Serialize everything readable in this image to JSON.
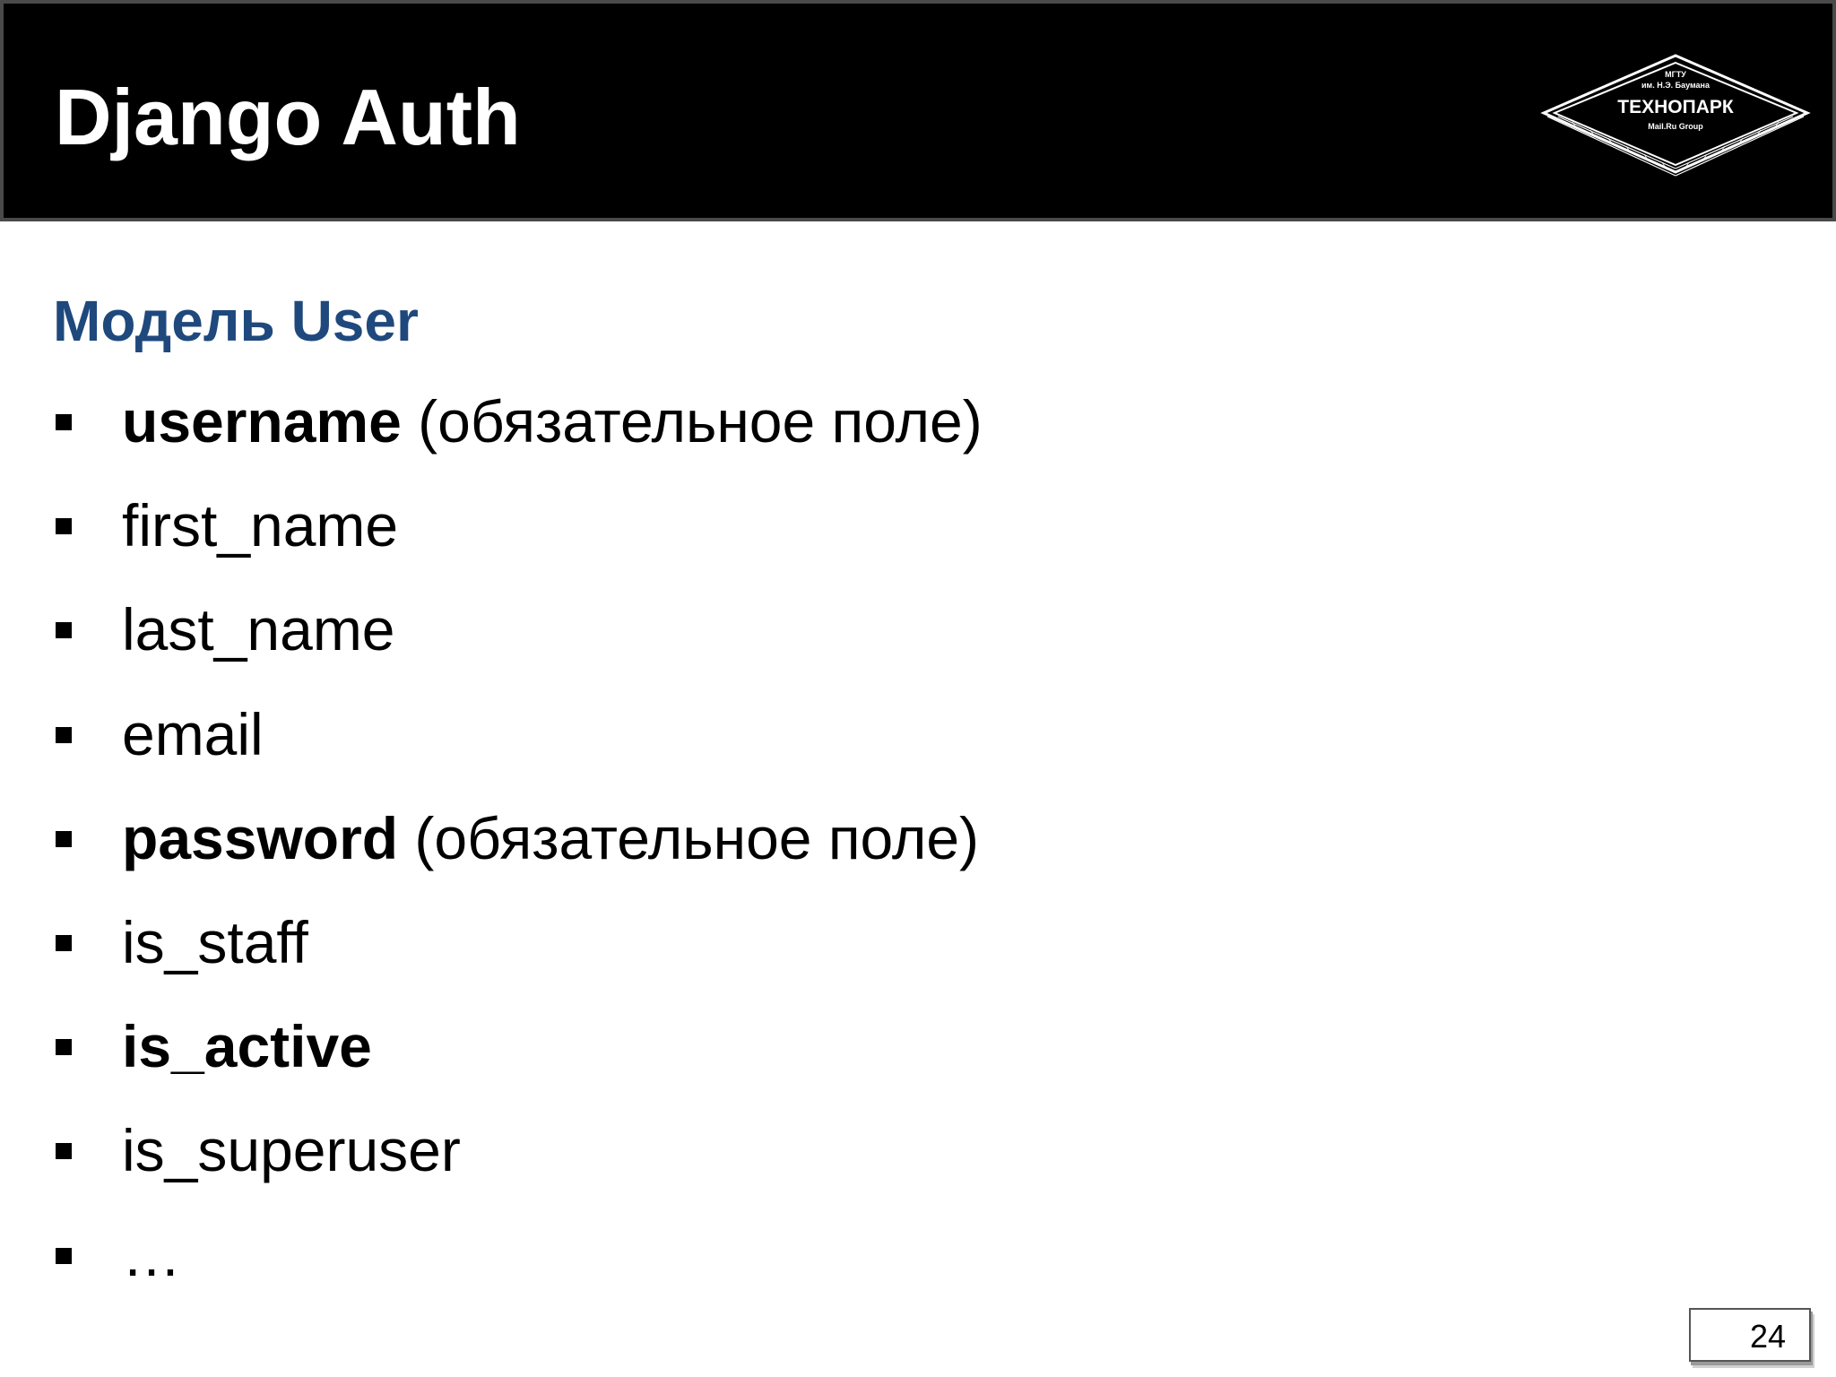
{
  "header": {
    "title": "Django Auth",
    "logo": {
      "line1": "МГТУ",
      "line2": "им. Н.Э. Баумана",
      "name": "ТЕХНОПАРК",
      "line4": "Mail.Ru Group"
    }
  },
  "content": {
    "section_title": "Модель User",
    "bullets": [
      {
        "strong": "username",
        "rest": " (обязательное поле)"
      },
      {
        "strong": "",
        "rest": "first_name"
      },
      {
        "strong": "",
        "rest": "last_name"
      },
      {
        "strong": "",
        "rest": "email"
      },
      {
        "strong": "password",
        "rest": " (обязательное поле)"
      },
      {
        "strong": "",
        "rest": "is_staff"
      },
      {
        "strong": "is_active",
        "rest": ""
      },
      {
        "strong": "",
        "rest": "is_superuser"
      },
      {
        "strong": "",
        "rest": "…"
      }
    ]
  },
  "footer": {
    "page_number": "24"
  },
  "colors": {
    "header_bg": "#000000",
    "section_title": "#1f497d",
    "text": "#000000"
  },
  "icons": {
    "logo": "technopark-diamond-logo",
    "bullet": "square-bullet-icon"
  }
}
